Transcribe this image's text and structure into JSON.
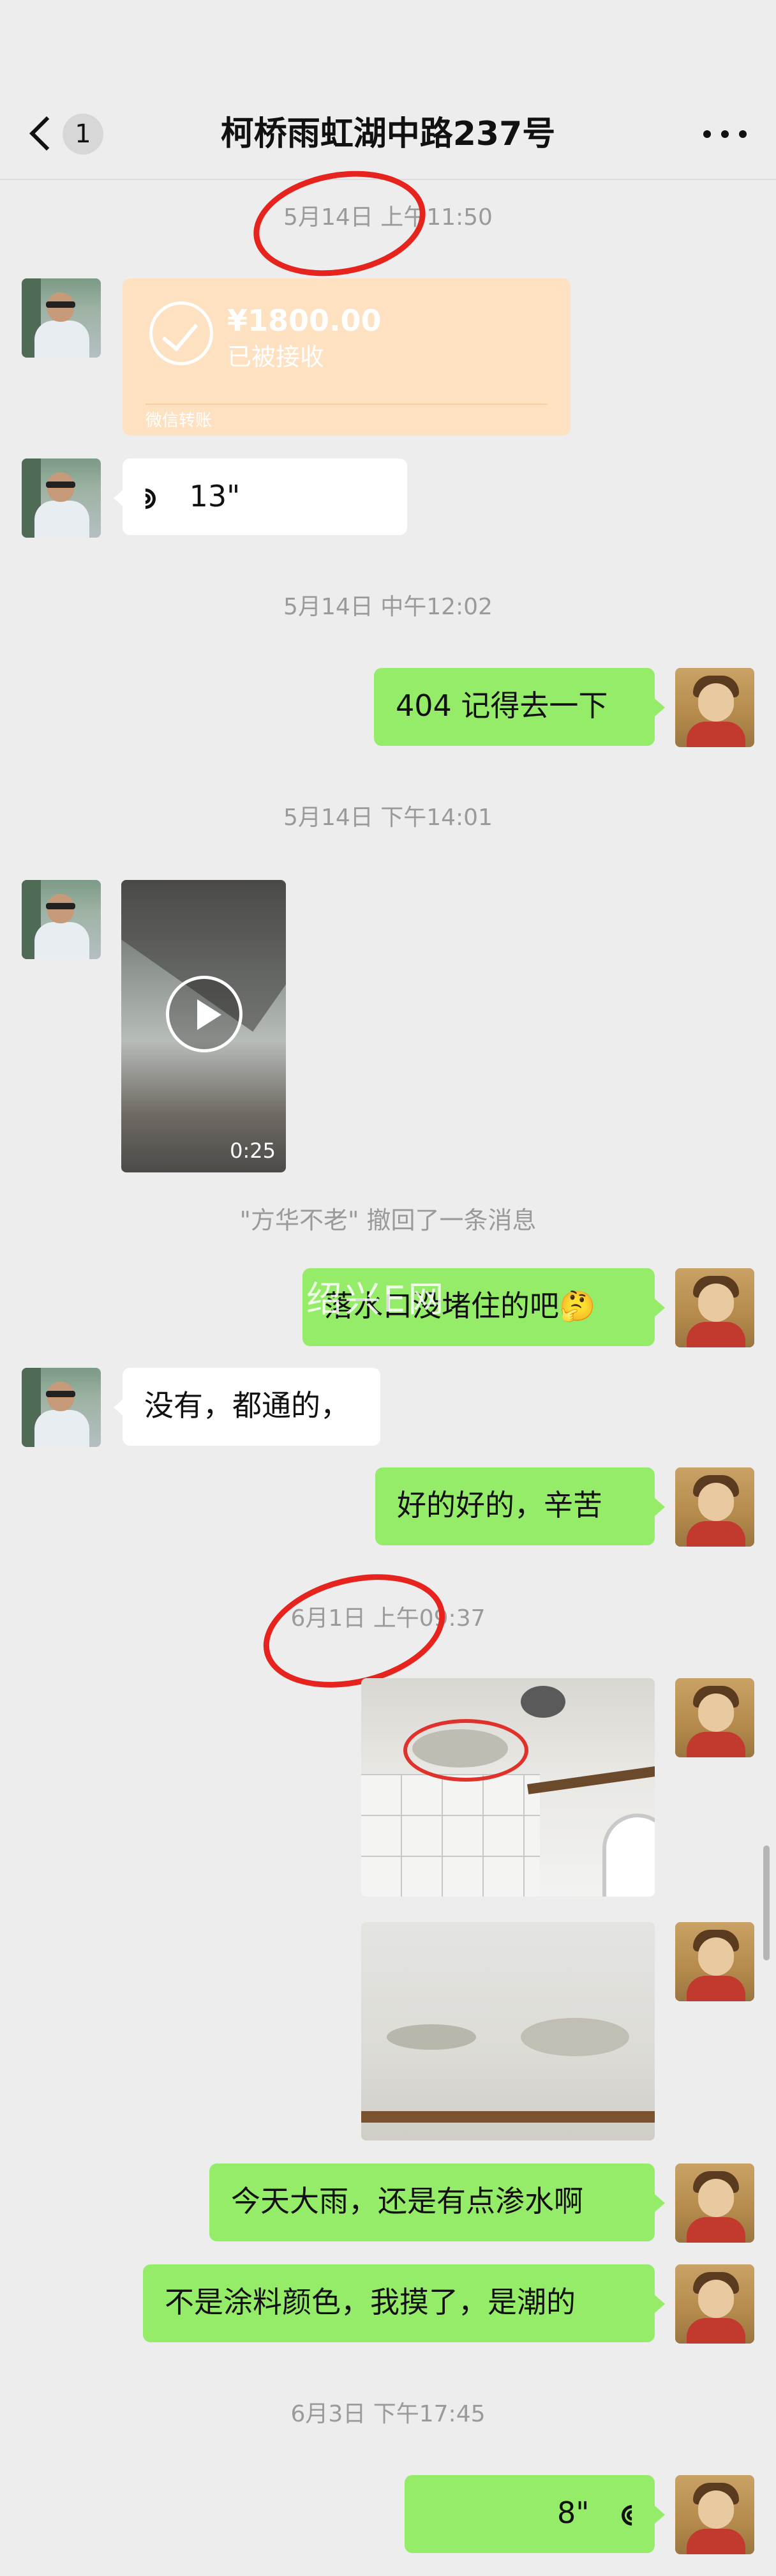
{
  "header": {
    "back_count": "1",
    "title": "柯桥雨虹湖中路237号"
  },
  "messages": {
    "time1": "5月14日 上午11:50",
    "transfer": {
      "amount": "¥1800.00",
      "status": "已被接收",
      "footer": "微信转账"
    },
    "voice1": "13\"",
    "time2": "5月14日 中午12:02",
    "text1": "404 记得去一下",
    "time3": "5月14日 下午14:01",
    "video_duration": "0:25",
    "recall": "\"方华不老\" 撤回了一条消息",
    "text2": "落水口没堵住的吧🤔",
    "text3": "没有，都通的，",
    "text4": "好的好的，辛苦",
    "time4": "6月1日 上午09:37",
    "text5": "今天大雨，还是有点渗水啊",
    "text6": "不是涂料颜色，我摸了，是潮的",
    "time5": "6月3日 下午17:45",
    "voice2": "8\""
  },
  "watermark": "绍兴E网",
  "colors": {
    "background": "#ededed",
    "bubble_right": "#95ec69",
    "bubble_left": "#ffffff",
    "transfer_card": "#fde1c1",
    "annotation": "#e6231d"
  },
  "icons": [
    "back-chevron-icon",
    "more-icon",
    "check-icon",
    "voice-icon",
    "play-icon"
  ]
}
